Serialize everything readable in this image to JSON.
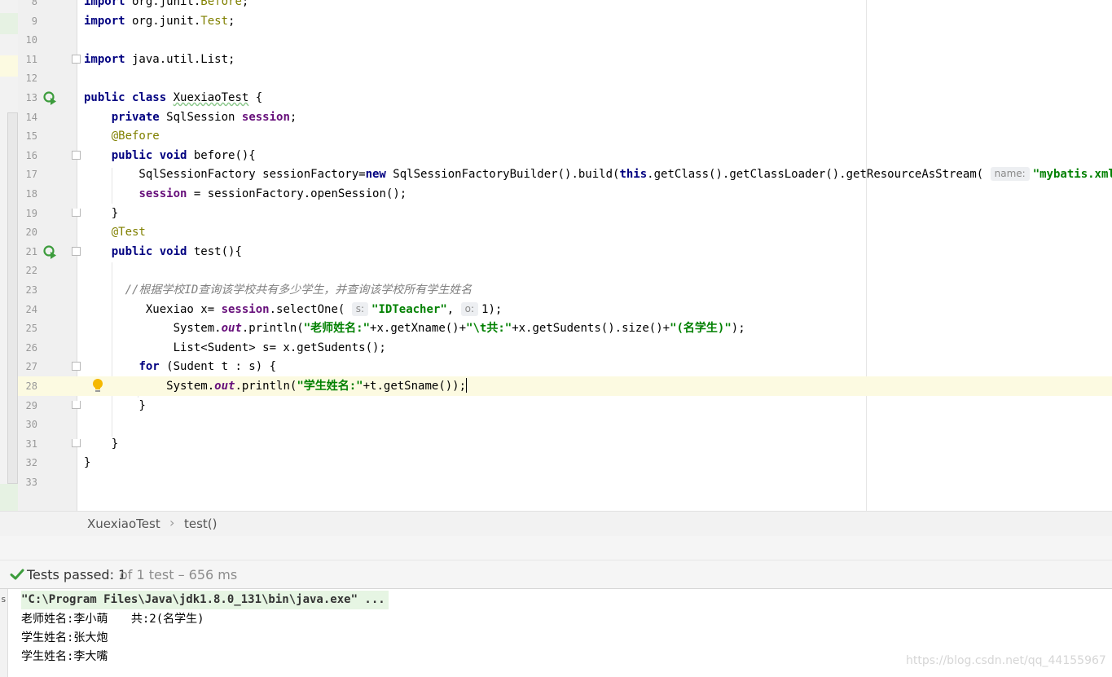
{
  "editor": {
    "lines": [
      {
        "n": "8",
        "html": "<span class=\"kw\">import</span> org.junit.<span class=\"ann\">Before</span>;"
      },
      {
        "n": "9",
        "html": "<span class=\"kw\">import</span> org.junit.<span class=\"ann\">Test</span>;"
      },
      {
        "n": "10",
        "html": ""
      },
      {
        "n": "11",
        "html": "<span class=\"kw\">import</span> java.util.List;"
      },
      {
        "n": "12",
        "html": ""
      },
      {
        "n": "13",
        "html": "<span class=\"kw\">public class</span> <span class=\"squiggle\">XuexiaoTest</span> {"
      },
      {
        "n": "14",
        "html": "    <span class=\"kw\">private</span> SqlSession <span class=\"fld\">session</span>;"
      },
      {
        "n": "15",
        "html": "    <span class=\"ann\">@Before</span>"
      },
      {
        "n": "16",
        "html": "    <span class=\"kw\">public void</span> before(){"
      },
      {
        "n": "17",
        "html": "        SqlSessionFactory sessionFactory=<span class=\"kw\">new</span> SqlSessionFactoryBuilder().build(<span class=\"kw\">this</span>.getClass().getClassLoader().getResourceAsStream( <span class=\"hint\">name:</span><span class=\"str\">\"mybatis.xml\"</span>));"
      },
      {
        "n": "18",
        "html": "        <span class=\"fld\">session</span> = sessionFactory.openSession();"
      },
      {
        "n": "19",
        "html": "    }"
      },
      {
        "n": "20",
        "html": "    <span class=\"ann\">@Test</span>"
      },
      {
        "n": "21",
        "html": "    <span class=\"kw\">public void</span> test(){"
      },
      {
        "n": "22",
        "html": ""
      },
      {
        "n": "23",
        "html": "      <span class=\"cmt\">//根据学校ID查询该学校共有多少学生，并查询该学校所有学生姓名</span>"
      },
      {
        "n": "24",
        "html": "         Xuexiao x= <span class=\"fld\">session</span>.selectOne( <span class=\"hint\">s:</span><span class=\"str\">\"IDTeacher\"</span>, <span class=\"hint\">o:</span>1);"
      },
      {
        "n": "25",
        "html": "             System.<span class=\"st\">out</span>.println(<span class=\"str\">\"老师姓名:\"</span>+x.getXname()+<span class=\"str\">\"\\t共:\"</span>+x.getSudents().size()+<span class=\"str\">\"(名学生)\"</span>);"
      },
      {
        "n": "26",
        "html": "             List&lt;Sudent&gt; s= x.getSudents();"
      },
      {
        "n": "27",
        "html": "        <span class=\"kw\">for</span> (Sudent t : s) {"
      },
      {
        "n": "28",
        "html": "            System.<span class=\"st\">out</span>.println(<span class=\"str\">\"学生姓名:\"</span>+t.getSname());<span class=\"caret\"></span>"
      },
      {
        "n": "29",
        "html": "        }"
      },
      {
        "n": "30",
        "html": ""
      },
      {
        "n": "31",
        "html": "    }"
      },
      {
        "n": "32",
        "html": "}"
      },
      {
        "n": "33",
        "html": ""
      }
    ]
  },
  "breadcrumb": {
    "class_name": "XuexiaoTest",
    "separator": "›",
    "method_name": "test()"
  },
  "status": {
    "passed_label": "Tests passed: 1",
    "detail": "of 1 test – 656 ms"
  },
  "console": {
    "edge_letters": "s",
    "lines": [
      "\"C:\\Program Files\\Java\\jdk1.8.0_131\\bin\\java.exe\" ...",
      "老师姓名:李小萌\t共:2(名学生)",
      "学生姓名:张大炮",
      "学生姓名:李大嘴"
    ]
  },
  "watermark": "https://blog.csdn.net/qq_44155967",
  "colors": {
    "keyword": "#000080",
    "field": "#660e7a",
    "string": "#008000",
    "annotation": "#808000",
    "comment": "#808080",
    "current_line": "#fcfae1",
    "pass_green": "#3c9c3c"
  }
}
